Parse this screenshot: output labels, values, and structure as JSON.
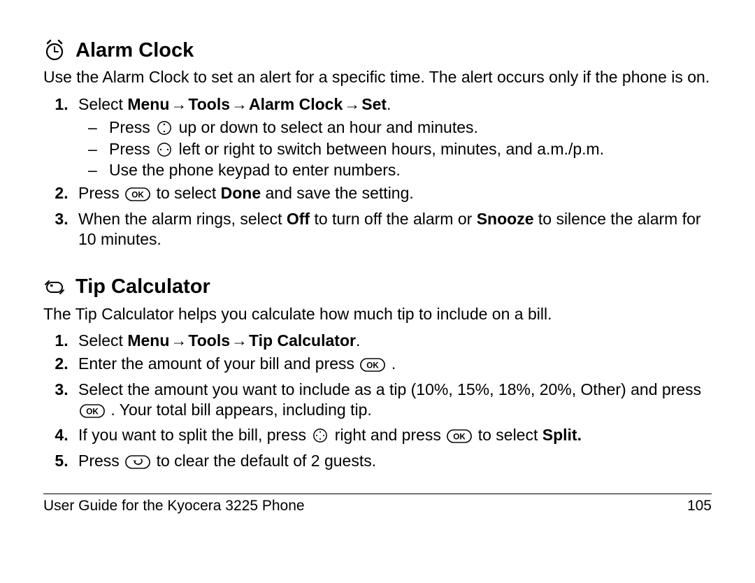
{
  "section1": {
    "title": "Alarm Clock",
    "intro": "Use the Alarm Clock to set an alert for a specific time. The alert occurs only if the phone is on.",
    "step1_prefix": "Select ",
    "step1_menu": "Menu",
    "step1_tools": "Tools",
    "step1_alarm": "Alarm Clock",
    "step1_set": "Set",
    "step1_sub1_a": "Press ",
    "step1_sub1_b": " up or down to select an hour and minutes.",
    "step1_sub2_a": "Press ",
    "step1_sub2_b": " left or right to switch between hours, minutes, and a.m./p.m.",
    "step1_sub3": "Use the phone keypad to enter numbers.",
    "step2_a": "Press ",
    "step2_b": " to select ",
    "step2_done": "Done",
    "step2_c": " and save the setting.",
    "step3_a": "When the alarm rings, select ",
    "step3_off": "Off",
    "step3_b": " to turn off the alarm or ",
    "step3_snooze": "Snooze",
    "step3_c": " to silence the alarm for 10 minutes."
  },
  "section2": {
    "title": "Tip Calculator",
    "intro": "The Tip Calculator helps you calculate how much tip to include on a bill.",
    "step1_prefix": "Select ",
    "step1_menu": "Menu",
    "step1_tools": "Tools",
    "step1_tip": "Tip Calculator",
    "step2_a": "Enter the amount of your bill and press ",
    "step2_b": " .",
    "step3_a": "Select the amount you want to include as a tip (10%, 15%, 18%, 20%, Other) and press ",
    "step3_b": " . Your total bill appears, including tip.",
    "step4_a": "If you want to split the bill, press ",
    "step4_b": " right and press ",
    "step4_c": " to select ",
    "step4_split": "Split.",
    "step5_a": "Press ",
    "step5_b": " to clear the default of 2 guests."
  },
  "footer": {
    "left": "User Guide for the Kyocera 3225 Phone",
    "right": "105"
  },
  "arrow": "→"
}
